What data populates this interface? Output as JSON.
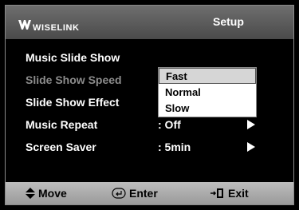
{
  "header": {
    "brand": "WISELINK",
    "title": "Setup"
  },
  "menu": {
    "rows": [
      {
        "label": "Music Slide Show",
        "value": "",
        "has_arrow": false,
        "dimmed": false
      },
      {
        "label": "Slide Show Speed",
        "value": ":",
        "has_arrow": false,
        "dimmed": true
      },
      {
        "label": "Slide Show Effect",
        "value": ":",
        "has_arrow": false,
        "dimmed": false
      },
      {
        "label": "Music Repeat",
        "value": ": Off",
        "has_arrow": true,
        "dimmed": false
      },
      {
        "label": "Screen Saver",
        "value": ": 5min",
        "has_arrow": true,
        "dimmed": false
      }
    ]
  },
  "dropdown": {
    "options": [
      "Fast",
      "Normal",
      "Slow"
    ],
    "selected": "Fast"
  },
  "footer": {
    "move": "Move",
    "enter": "Enter",
    "exit": "Exit"
  },
  "icons": {
    "logo": "wiselink-logo-icon",
    "move": "up-down-arrow-icon",
    "enter": "enter-return-icon",
    "exit": "exit-door-icon",
    "submenu": "right-triangle-icon"
  },
  "colors": {
    "header": "#5c5c5c",
    "footer": "#ababab",
    "text": "#ffffff",
    "dimmed_text": "#8c8c8c",
    "dropdown_bg": "#ffffff",
    "dropdown_selected": "#d6d6d6"
  }
}
